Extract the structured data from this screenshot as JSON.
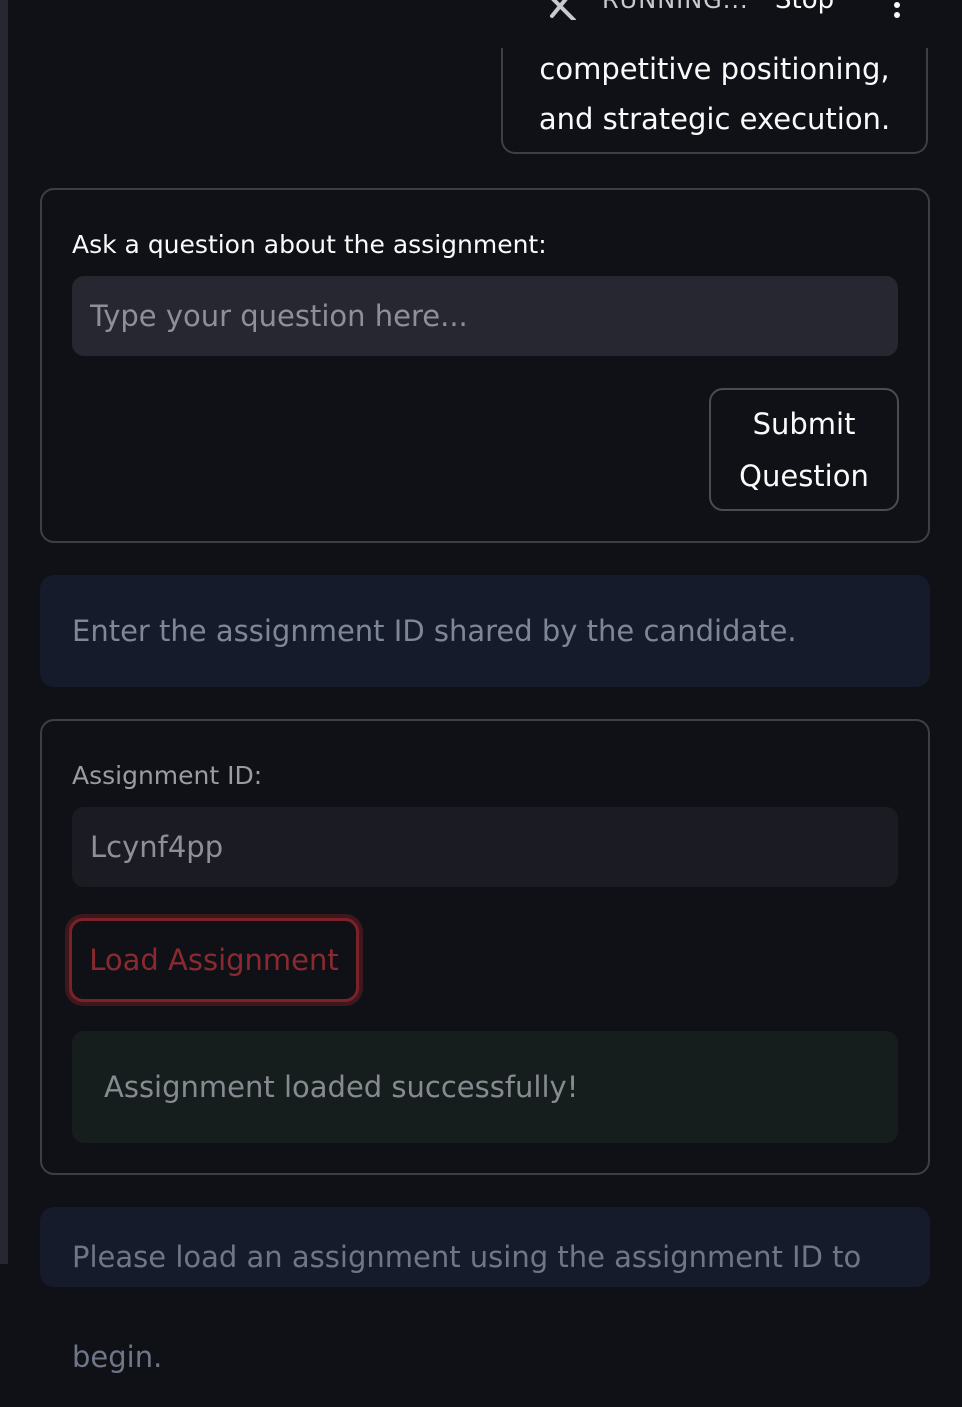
{
  "header": {
    "status_text": "RUNNING...",
    "stop_label": "Stop"
  },
  "chat": {
    "lines": [
      "competitive positioning,",
      "and strategic execution."
    ]
  },
  "question_form": {
    "label": "Ask a question about the assignment:",
    "placeholder": "Type your question here...",
    "value": "",
    "submit_line1": "Submit",
    "submit_line2": "Question"
  },
  "info_assignment_id": "Enter the assignment ID shared by the candidate.",
  "assignment_form": {
    "label": "Assignment ID:",
    "value": "Lcynf4pp",
    "load_label": "Load Assignment",
    "success_message": "Assignment loaded successfully!"
  },
  "info_load_prompt": "Please load an assignment using the assignment ID to begin."
}
